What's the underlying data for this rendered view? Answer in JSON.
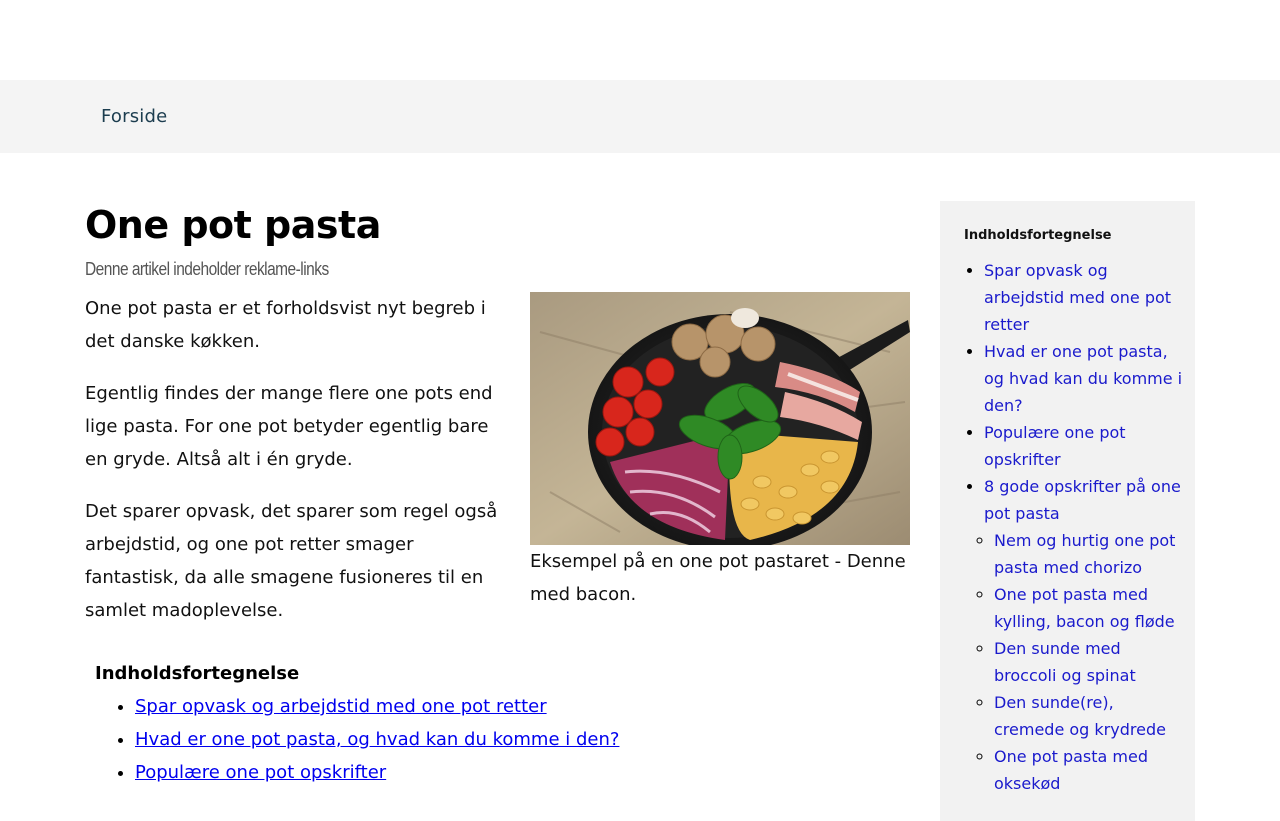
{
  "nav": {
    "home": "Forside"
  },
  "article": {
    "title": "One pot pasta",
    "disclaimer": "Denne artikel indeholder reklame-links",
    "paragraphs": [
      "One pot pasta er et forholdsvist nyt begreb i det danske køkken.",
      "Egentlig findes der mange flere one pots end lige pasta. For one pot betyder egentlig bare en gryde. Altså alt i én gryde.",
      "Det sparer opvask, det sparer som regel også arbejdstid, og one pot retter smager fantastisk, da alle smagene fusioneres til en samlet madoplevelse."
    ],
    "caption": "Eksempel på en one pot pastaret - Denne med bacon."
  },
  "toc": {
    "heading": "Indholdsfortegnelse",
    "items": [
      "Spar opvask og arbejdstid med one pot retter",
      "Hvad er one pot pasta, og hvad kan du komme i den?",
      "Populære one pot opskrifter"
    ]
  },
  "sidebar": {
    "heading": "Indholdsfortegnelse",
    "items": [
      "Spar opvask og arbejdstid med one pot retter",
      "Hvad er one pot pasta, og hvad kan du komme i den?",
      "Populære one pot opskrifter",
      "8 gode opskrifter på one pot pasta"
    ],
    "subitems": [
      "Nem og hurtig one pot pasta med chorizo",
      "One pot pasta med kylling, bacon og fløde",
      "Den sunde med broccoli og spinat",
      "Den sunde(re), cremede og krydrede",
      "One pot pasta med oksekød"
    ]
  }
}
